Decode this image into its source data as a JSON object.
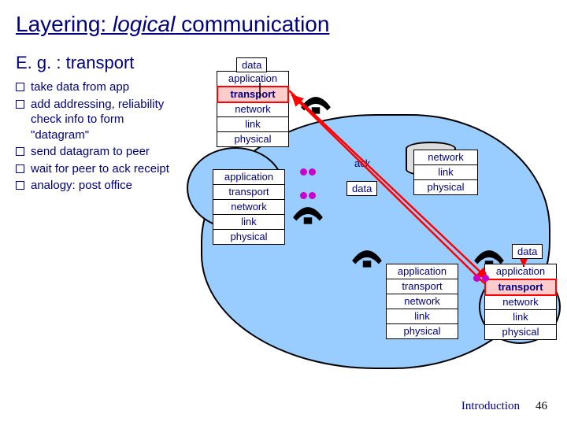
{
  "title": {
    "pre": "Layering: ",
    "em": "logical",
    "post": " communication"
  },
  "subtitle": "E. g. : transport",
  "bullets": [
    "take data from app",
    "add addressing, reliability check info to form \"datagram\"",
    "send datagram to peer",
    "wait for peer to ack receipt",
    "analogy: post office"
  ],
  "layers": {
    "full": [
      "application",
      "transport",
      "network",
      "link",
      "physical"
    ],
    "router": [
      "network",
      "link",
      "physical"
    ]
  },
  "labels": {
    "data": "data",
    "ack": "ack"
  },
  "footer": {
    "section": "Introduction",
    "page": "46"
  }
}
